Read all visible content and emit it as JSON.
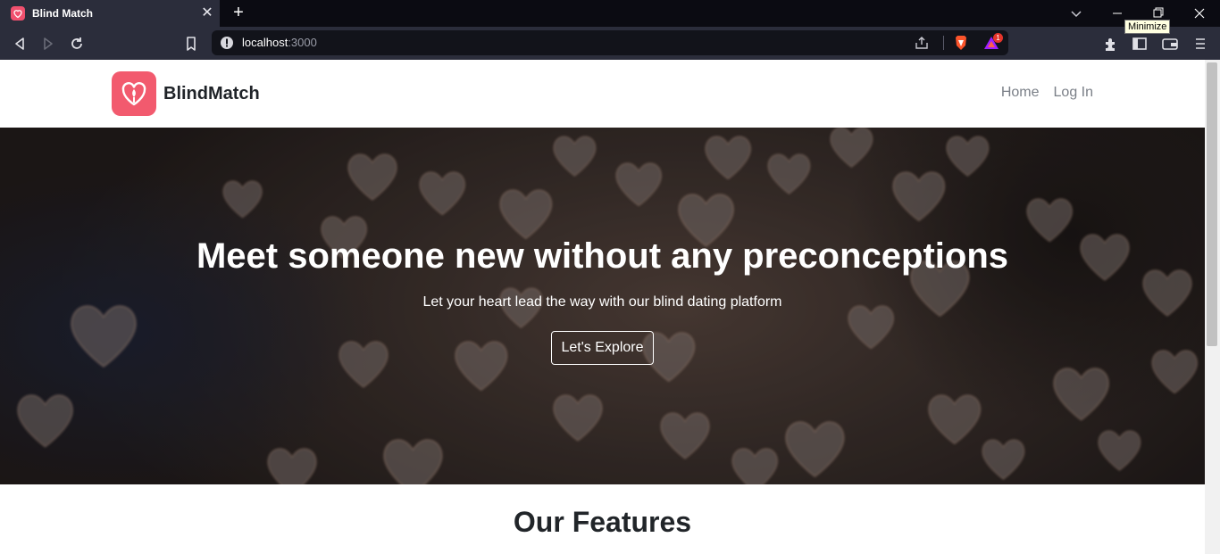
{
  "browser": {
    "tab_title": "Blind Match",
    "url_host": "localhost",
    "url_port": ":3000",
    "tooltip": "Minimize",
    "rewards_count": "1"
  },
  "nav": {
    "brand": "BlindMatch",
    "links": [
      "Home",
      "Log In"
    ]
  },
  "hero": {
    "title": "Meet someone new without any preconceptions",
    "subtitle": "Let your heart lead the way with our blind dating platform",
    "button": "Let's Explore"
  },
  "features": {
    "title": "Our Features"
  },
  "colors": {
    "brand": "#f25a6e",
    "chrome_dark": "#0b0b12",
    "toolbar": "#2b2d3b"
  },
  "icons": [
    "heart-logo-icon",
    "back-icon",
    "forward-icon",
    "reload-icon",
    "bookmark-icon",
    "info-icon",
    "share-icon",
    "brave-shield-icon",
    "brave-rewards-icon",
    "extensions-icon",
    "sidebar-icon",
    "wallet-icon",
    "menu-icon",
    "tab-search-icon",
    "minimize-icon",
    "restore-icon",
    "close-icon"
  ]
}
